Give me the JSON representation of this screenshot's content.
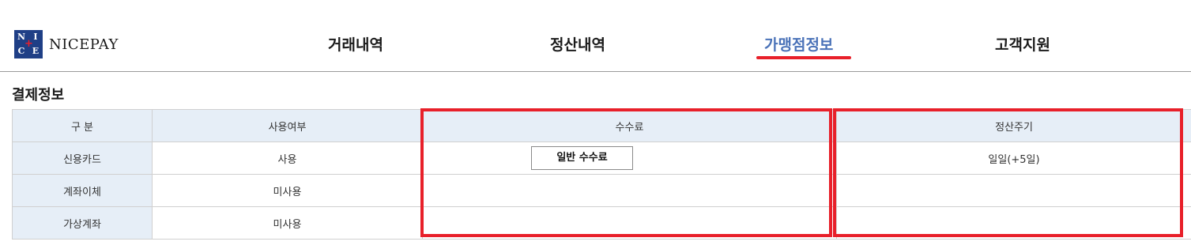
{
  "brand": {
    "logo_letters": [
      "N",
      "I",
      "C",
      "E"
    ],
    "name": "NICEPAY",
    "colors": {
      "logo_bg": "#1f3f86",
      "accent_red": "#e8202a",
      "active_blue": "#4a72b8"
    }
  },
  "nav": {
    "items": [
      {
        "label": "거래내역",
        "active": false
      },
      {
        "label": "정산내역",
        "active": false
      },
      {
        "label": "가맹점정보",
        "active": true
      },
      {
        "label": "고객지원",
        "active": false
      }
    ]
  },
  "section": {
    "title": "결제정보"
  },
  "table": {
    "headers": [
      "구 분",
      "사용여부",
      "수수료",
      "정산주기"
    ],
    "rows": [
      {
        "type": "신용카드",
        "usage": "사용",
        "fee_button": "일반 수수료",
        "cycle": "일일(+5일)"
      },
      {
        "type": "계좌이체",
        "usage": "미사용",
        "fee_button": "",
        "cycle": ""
      },
      {
        "type": "가상계좌",
        "usage": "미사용",
        "fee_button": "",
        "cycle": ""
      }
    ]
  }
}
